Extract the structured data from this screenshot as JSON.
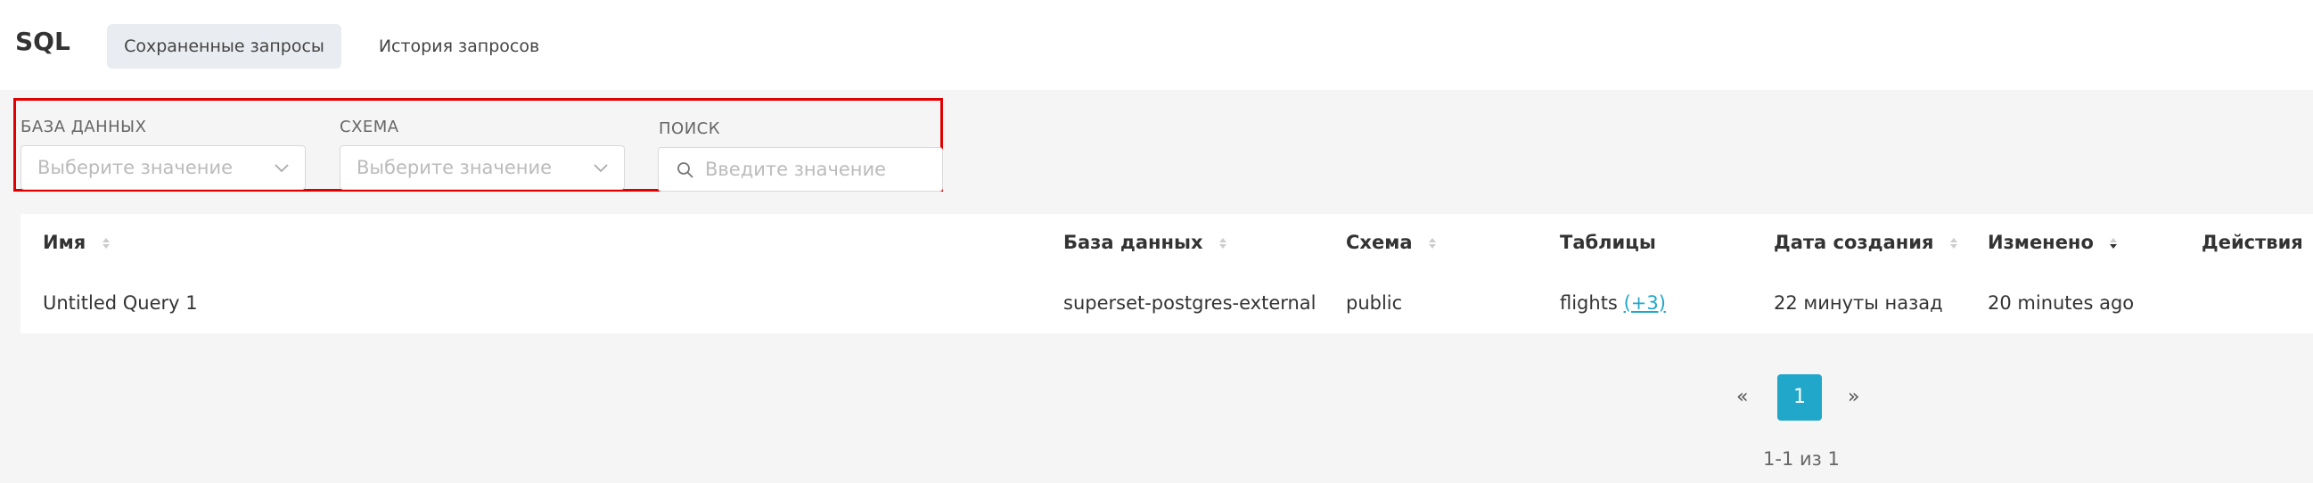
{
  "header": {
    "brand": "SQL",
    "tabs": [
      {
        "label": "Сохраненные запросы",
        "active": true
      },
      {
        "label": "История запросов",
        "active": false
      }
    ]
  },
  "filters": {
    "database": {
      "label": "БАЗА ДАННЫХ",
      "placeholder": "Выберите значение"
    },
    "schema": {
      "label": "СХЕМА",
      "placeholder": "Выберите значение"
    },
    "search": {
      "label": "ПОИСК",
      "placeholder": "Введите значение"
    }
  },
  "table": {
    "columns": [
      "Имя",
      "База данных",
      "Схема",
      "Таблицы",
      "Дата создания",
      "Изменено",
      "Действия"
    ],
    "rows": [
      {
        "name": "Untitled Query 1",
        "database": "superset-postgres-external",
        "schema": "public",
        "tables": "flights",
        "tables_more": "(+3)",
        "created": "22 минуты назад",
        "modified": "20 minutes ago"
      }
    ]
  },
  "pagination": {
    "prev": "«",
    "current_page": "1",
    "next": "»",
    "summary": "1-1 из 1"
  },
  "colors": {
    "accent": "#20a7c9",
    "highlight_border": "#e00000",
    "active_tab_bg": "#e9ecf0"
  }
}
